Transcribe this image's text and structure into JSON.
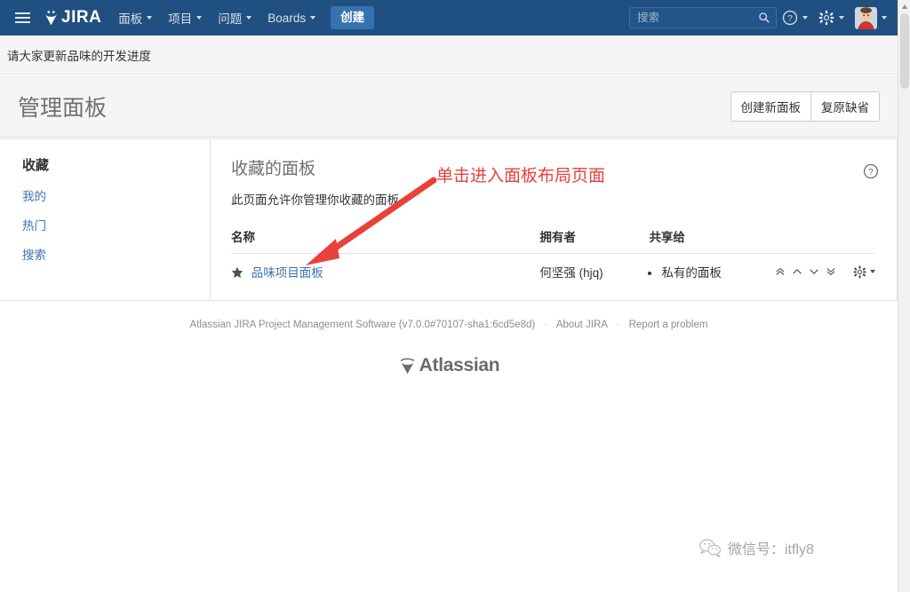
{
  "colors": {
    "nav_bg": "#205081",
    "create_btn": "#3572b0",
    "link": "#3b73af",
    "annotation_red": "#e8413a",
    "page_bg": "#f5f5f5"
  },
  "topnav": {
    "menu_icon": "hamburger-icon",
    "logo_text": "JIRA",
    "items": [
      {
        "label": "面板",
        "has_caret": true
      },
      {
        "label": "项目",
        "has_caret": true
      },
      {
        "label": "问题",
        "has_caret": true
      },
      {
        "label": "Boards",
        "has_caret": true
      }
    ],
    "create_label": "创建",
    "search": {
      "placeholder": "搜索",
      "value": "",
      "icon": "search-icon"
    },
    "help_icon": "question-circle-icon",
    "settings_icon": "gear-icon",
    "avatar_icon": "user-avatar"
  },
  "announcement": {
    "text": "请大家更新品味的开发进度"
  },
  "page_header": {
    "title": "管理面板",
    "buttons": [
      {
        "label": "创建新面板"
      },
      {
        "label": "复原缺省"
      }
    ]
  },
  "sidebar": {
    "heading": "收藏",
    "items": [
      {
        "label": "我的"
      },
      {
        "label": "热门"
      },
      {
        "label": "搜索"
      }
    ]
  },
  "main": {
    "heading": "收藏的面板",
    "description": "此页面允许你管理你收藏的面板",
    "help_icon": "question-circle-icon",
    "table": {
      "columns": [
        "名称",
        "拥有者",
        "共享给",
        ""
      ],
      "rows": [
        {
          "starred": true,
          "star_icon": "star-filled-icon",
          "name": "品味项目面板",
          "owner": "何坚强 (hjq)",
          "shared_with": [
            "私有的面板"
          ],
          "actions": [
            {
              "icon": "chevron-double-up-icon",
              "title": "移到最前"
            },
            {
              "icon": "chevron-up-icon",
              "title": "上移"
            },
            {
              "icon": "chevron-down-icon",
              "title": "下移"
            },
            {
              "icon": "chevron-double-down-icon",
              "title": "移到最后"
            }
          ],
          "menu_icon": "gear-icon"
        }
      ]
    }
  },
  "annotation": {
    "text": "单击进入面板布局页面"
  },
  "footer": {
    "product": "Atlassian JIRA Project Management Software (v7.0.0#70107-sha1:6cd5e8d)",
    "links": [
      {
        "label": "About JIRA"
      },
      {
        "label": "Report a problem"
      }
    ],
    "brand": "Atlassian",
    "brand_icon": "atlassian-logo-icon"
  },
  "watermark": {
    "icon": "wechat-icon",
    "text": "微信号：itfly8"
  },
  "scrollbar": {
    "up_arrow_icon": "scroll-up-arrow-icon"
  }
}
